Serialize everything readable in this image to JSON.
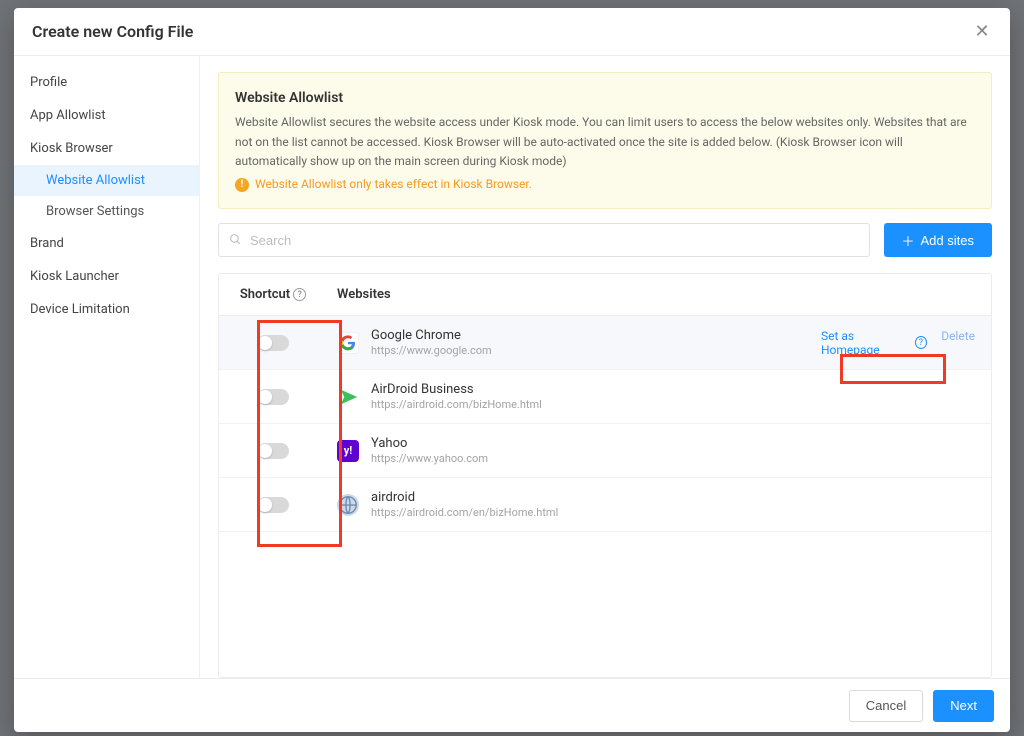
{
  "modal": {
    "title": "Create new Config File"
  },
  "sidebar": {
    "items": [
      {
        "label": "Profile",
        "type": "item"
      },
      {
        "label": "App Allowlist",
        "type": "item"
      },
      {
        "label": "Kiosk Browser",
        "type": "item"
      },
      {
        "label": "Website Allowlist",
        "type": "sub",
        "active": true
      },
      {
        "label": "Browser Settings",
        "type": "sub"
      },
      {
        "label": "Brand",
        "type": "item"
      },
      {
        "label": "Kiosk Launcher",
        "type": "item"
      },
      {
        "label": "Device Limitation",
        "type": "item"
      }
    ]
  },
  "info": {
    "title": "Website Allowlist",
    "body": "Website Allowlist secures the website access under Kiosk mode. You can limit users to access the below websites only. Websites that are not on the list cannot be accessed. Kiosk Browser will be auto-activated once the site is added below. (Kiosk Browser icon will automatically show up on the main screen during Kiosk mode)",
    "warn": "Website Allowlist only takes effect in Kiosk Browser."
  },
  "search": {
    "placeholder": "Search"
  },
  "add_button": "Add sites",
  "table": {
    "headers": {
      "shortcut": "Shortcut",
      "websites": "Websites"
    },
    "rows": [
      {
        "name": "Google Chrome",
        "url": "https://www.google.com",
        "icon": "google",
        "hovered": true,
        "set_homepage": "Set as Homepage",
        "delete": "Delete"
      },
      {
        "name": "AirDroid Business",
        "url": "https://airdroid.com/bizHome.html",
        "icon": "airdroid"
      },
      {
        "name": "Yahoo",
        "url": "https://www.yahoo.com",
        "icon": "yahoo"
      },
      {
        "name": "airdroid",
        "url": "https://airdroid.com/en/bizHome.html",
        "icon": "globe"
      }
    ]
  },
  "footer": {
    "cancel": "Cancel",
    "next": "Next"
  }
}
